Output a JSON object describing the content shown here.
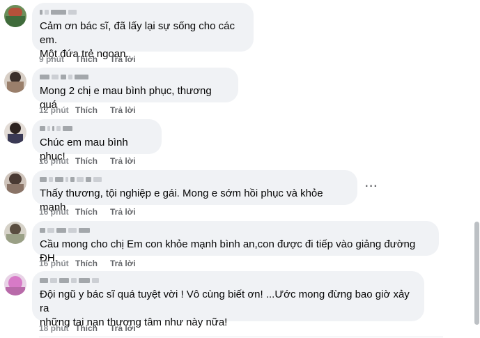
{
  "comments": [
    {
      "text": "Cảm ơn bác sĩ, đã lấy lại sự sống cho các em. Một đứa trẻ ngoan.",
      "lines": [
        "Cảm ơn bác sĩ, đã lấy lại sự sống cho các em.",
        "Một đứa trẻ ngoan."
      ],
      "time": "9 phút",
      "like": "Thích",
      "reply": "Trả lời"
    },
    {
      "lines": [
        "Mong 2 chị e mau bình phục, thương quá"
      ],
      "time": "12 phút",
      "like": "Thích",
      "reply": "Trả lời"
    },
    {
      "lines": [
        "Chúc em mau bình phục!"
      ],
      "time": "16 phút",
      "like": "Thích",
      "reply": "Trả lời"
    },
    {
      "lines": [
        "Thấy thương, tội nghiệp e gái. Mong e sớm hồi phục và khỏe mạnh"
      ],
      "time": "16 phút",
      "like": "Thích",
      "reply": "Trả lời",
      "more": "···"
    },
    {
      "lines": [
        "Cầu mong cho chị Em con khỏe mạnh bình an,con được đi tiếp vào giảng đường ĐH."
      ],
      "time": "16 phút",
      "like": "Thích",
      "reply": "Trả lời"
    },
    {
      "lines": [
        "Đội ngũ y bác sĩ quá tuyệt vời ! Vô cùng biết ơn! ...Ước mong đừng bao giờ xảy ra",
        "những tai nạn thương tâm như này nữa!"
      ],
      "time": "18 phút",
      "like": "Thích",
      "reply": "Trả lời"
    }
  ],
  "colors": {
    "bubble": "#f0f2f5",
    "meta": "#65676b",
    "text": "#050505"
  },
  "icons": {
    "more": "more-options-icon"
  }
}
